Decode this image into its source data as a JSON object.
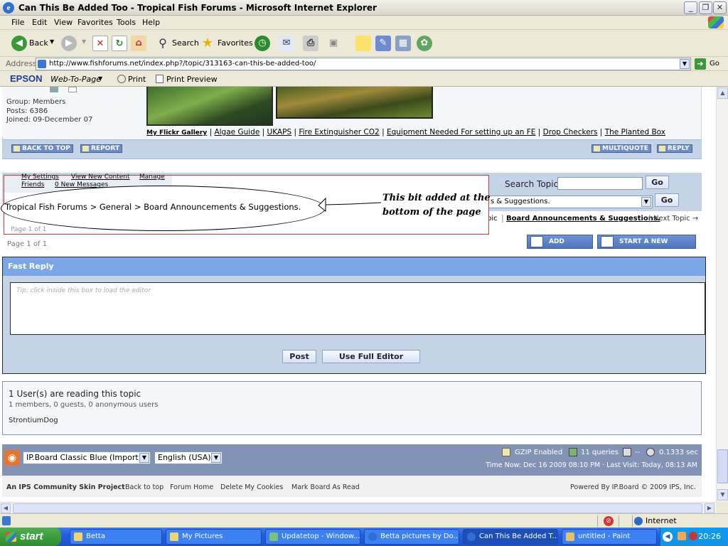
{
  "window": {
    "title": "Can This Be Added Too - Tropical Fish Forums - Microsoft Internet Explorer",
    "min": "_",
    "max": "❐",
    "close": "✕"
  },
  "menu": [
    "File",
    "Edit",
    "View",
    "Favorites",
    "Tools",
    "Help"
  ],
  "toolbar": {
    "back": "Back",
    "search": "Search",
    "favorites": "Favorites"
  },
  "address": {
    "label": "Address",
    "url": "http://www.fishforums.net/index.php?/topic/313163-can-this-be-added-too/",
    "go": "Go"
  },
  "epson": {
    "brand": "EPSON",
    "web_to_page": "Web-To-Page",
    "print": "Print",
    "print_preview": "Print Preview"
  },
  "profile": {
    "group": "Group:  Members",
    "posts": "Posts:  6386",
    "joined": "Joined:  09-December 07"
  },
  "signature_links": [
    "My Flickr Gallery",
    "Algae Guide",
    "UKAPS",
    "Fire Extinguisher CO2",
    "Equipment Needed For setting up an FE",
    "Drop Checkers",
    "The Planted Box"
  ],
  "post_buttons": {
    "back_to_top": "BACK TO TOP",
    "report": "REPORT",
    "multiquote": "MULTIQUOTE",
    "reply": "REPLY"
  },
  "annotation": {
    "menu_partial": [
      "My Settings",
      "View New Content",
      "Manage",
      "Friends",
      "0 New Messages"
    ],
    "breadcrumb": "Tropical Fish Forums > General > Board Announcements & Suggestions.",
    "page_partial": "Page 1 of 1",
    "note_line1": "This bit added at the",
    "note_line2": "bottom of the page"
  },
  "search": {
    "label": "Search Topic",
    "value": "",
    "go": "Go"
  },
  "jump": {
    "selected": "s & Suggestions.",
    "go": "Go"
  },
  "topic_nav": {
    "prev_partial": "pic",
    "forum_link": "Board Announcements & Suggestions.",
    "next": "Next Topic →"
  },
  "pagination": {
    "label": "Page 1 of 1"
  },
  "topic_buttons": {
    "add_reply": "ADD REPLY",
    "start_topic": "START A NEW TOPIC"
  },
  "fast_reply": {
    "title": "Fast Reply",
    "placeholder": "Tip: click inside this box to load the editor",
    "post": "Post",
    "full_editor": "Use Full Editor"
  },
  "readers": {
    "title": "1 User(s) are reading this topic",
    "breakdown": "1 members, 0 guests, 0 anonymous users",
    "users": [
      "StrontiumDog"
    ]
  },
  "footer": {
    "skin": "IP.Board Classic Blue (Import)",
    "language": "English (USA)",
    "stats": [
      "GZIP Enabled",
      "11 queries",
      "--",
      "0.1333 sec"
    ],
    "time": "Time Now: Dec 16 2009 08:10 PM · Last Visit: Today, 08:13 AM",
    "project": "An IPS Community Skin Project",
    "links": [
      "Back to top",
      "Forum Home",
      "Delete My Cookies",
      "Mark Board As Read"
    ],
    "powered": "Powered By IP.Board © 2009  IPS, Inc."
  },
  "statusbar": {
    "zone": "Internet"
  },
  "taskbar": {
    "start": "start",
    "tasks": [
      "Betta",
      "My Pictures",
      "Updatetop - Window...",
      "Betta pictures by Do...",
      "Can This Be Added T...",
      "untitled - Paint"
    ],
    "clock": "20:26"
  },
  "colors": {
    "forum_blue": "#7ba7e6",
    "panel_blue": "#c5d3e7",
    "footer_blue": "#8393b5",
    "annotation_red": "#d93a3a"
  }
}
